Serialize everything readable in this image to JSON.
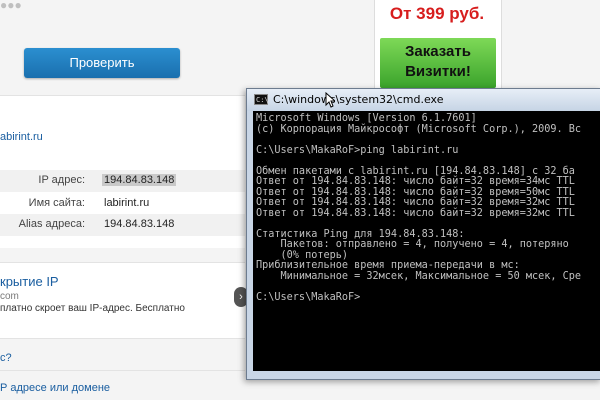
{
  "web_page": {
    "verify_button": "Проверить",
    "site_link": "abirint.ru",
    "info_rows": [
      {
        "label": "IP адрес:",
        "value": "194.84.83.148",
        "selected": true
      },
      {
        "label": "Имя сайта:",
        "value": "labirint.ru",
        "selected": false
      },
      {
        "label": "Alias адреса:",
        "value": "194.84.83.148",
        "selected": false
      }
    ],
    "ad": {
      "title": "крытие IP",
      "domain": "com",
      "text": "платно скроет ваш IP-адрес. Бесплатно"
    },
    "question_text": "с?",
    "bottom_link": "Р адресе или домене",
    "banner": {
      "price": "От 399 руб.",
      "cta_line1": "Заказать",
      "cta_line2": "Визитки!"
    }
  },
  "cmd_window": {
    "title": "C:\\windows\\system32\\cmd.exe",
    "lines": [
      "Microsoft Windows [Version 6.1.7601]",
      "(c) Корпорация Майкрософт (Microsoft Corp.), 2009. Вс",
      "",
      "C:\\Users\\MakaRoF>ping labirint.ru",
      "",
      "Обмен пакетами с labirint.ru [194.84.83.148] с 32 ба",
      "Ответ от 194.84.83.148: число байт=32 время=34мс TTL",
      "Ответ от 194.84.83.148: число байт=32 время=50мс TTL",
      "Ответ от 194.84.83.148: число байт=32 время=32мс TTL",
      "Ответ от 194.84.83.148: число байт=32 время=32мс TTL",
      "",
      "Статистика Ping для 194.84.83.148:",
      "    Пакетов: отправлено = 4, получено = 4, потеряно",
      "    (0% потерь)",
      "Приблизительное время приема-передачи в мс:",
      "    Минимальное = 32мсек, Максимальное = 50 мсек, Сре",
      "",
      "C:\\Users\\MakaRoF>"
    ]
  }
}
